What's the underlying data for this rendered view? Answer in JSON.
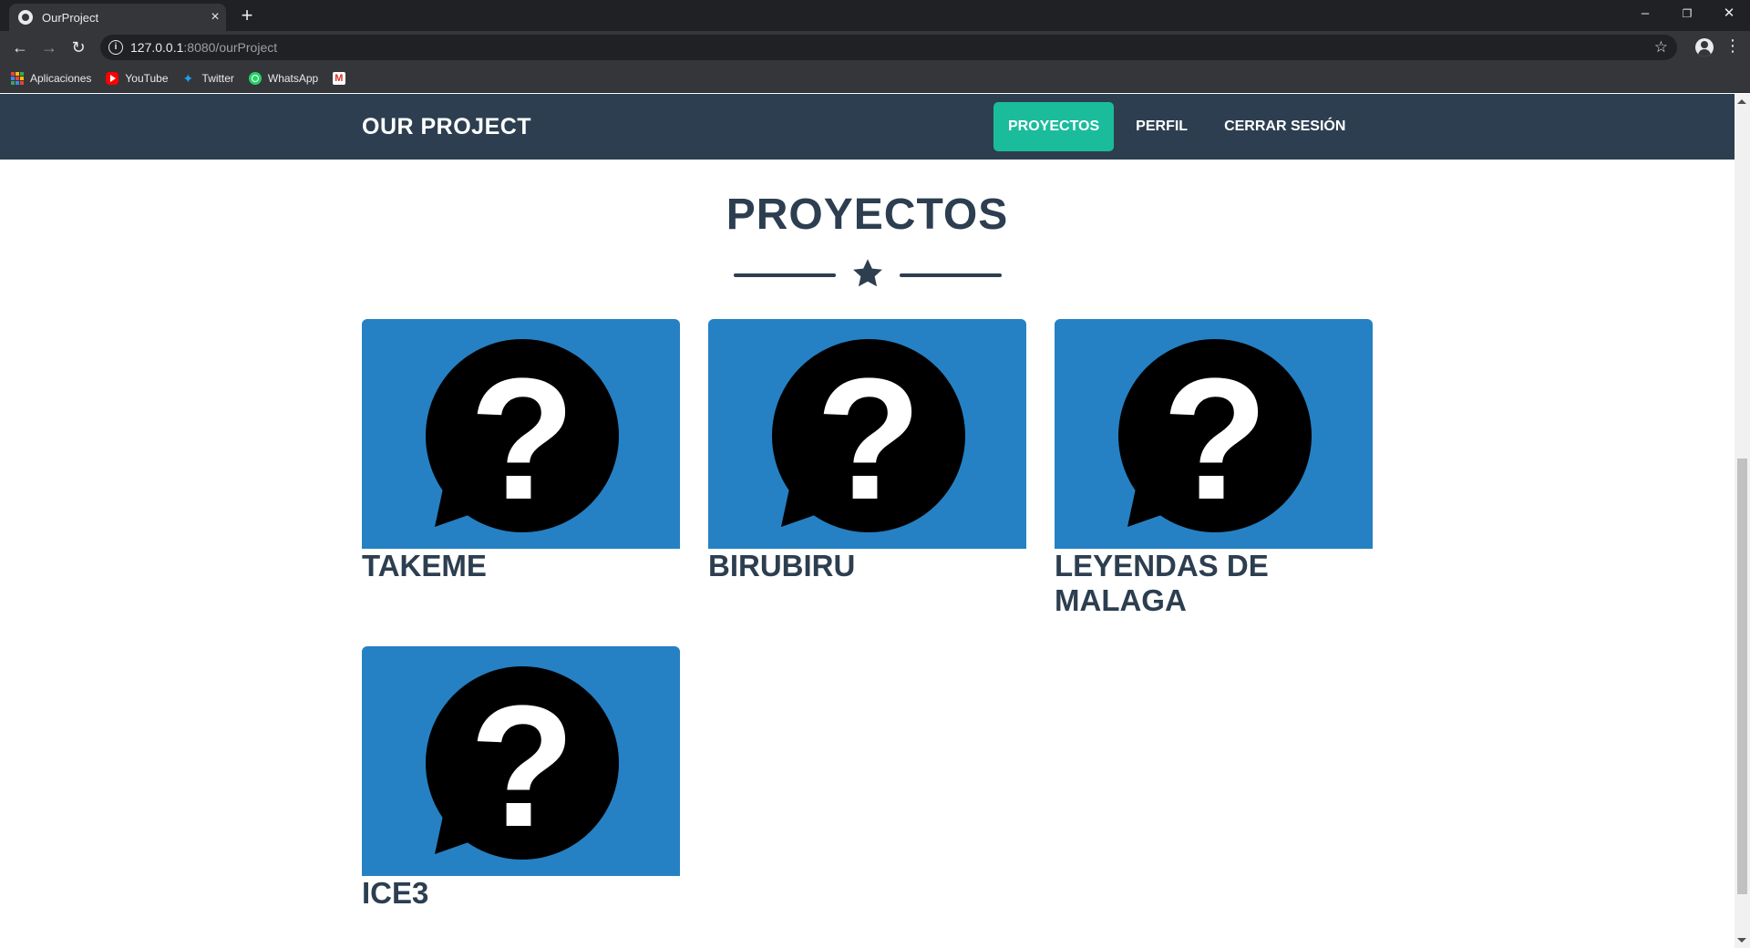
{
  "browser": {
    "tab_title": "OurProject",
    "tab_close": "×",
    "new_tab": "+",
    "url_host": "127.0.0.1",
    "url_rest": ":8080/ourProject",
    "window_controls": [
      "–",
      "❐",
      "✕"
    ],
    "bookmarks": [
      {
        "label": "Aplicaciones",
        "icon": "apps-icon"
      },
      {
        "label": "YouTube",
        "icon": "youtube-icon"
      },
      {
        "label": "Twitter",
        "icon": "twitter-icon"
      },
      {
        "label": "WhatsApp",
        "icon": "whatsapp-icon"
      },
      {
        "label": "",
        "icon": "gmail-icon"
      }
    ]
  },
  "site": {
    "brand": "OUR PROJECT",
    "nav": [
      {
        "label": "PROYECTOS",
        "active": true
      },
      {
        "label": "PERFIL",
        "active": false
      },
      {
        "label": "CERRAR SESIÓN",
        "active": false
      }
    ],
    "accent_color": "#1abc9c",
    "nav_color": "#2c3e50"
  },
  "main": {
    "title": "PROYECTOS",
    "divider_icon": "star-icon",
    "card_color": "#2581c4",
    "projects": [
      {
        "name": "TAKEME",
        "image_icon": "question-bubble-icon"
      },
      {
        "name": "BIRUBIRU",
        "image_icon": "question-bubble-icon"
      },
      {
        "name": "LEYENDAS DE MALAGA",
        "image_icon": "question-bubble-icon"
      },
      {
        "name": "ICE3",
        "image_icon": "question-bubble-icon"
      }
    ]
  }
}
